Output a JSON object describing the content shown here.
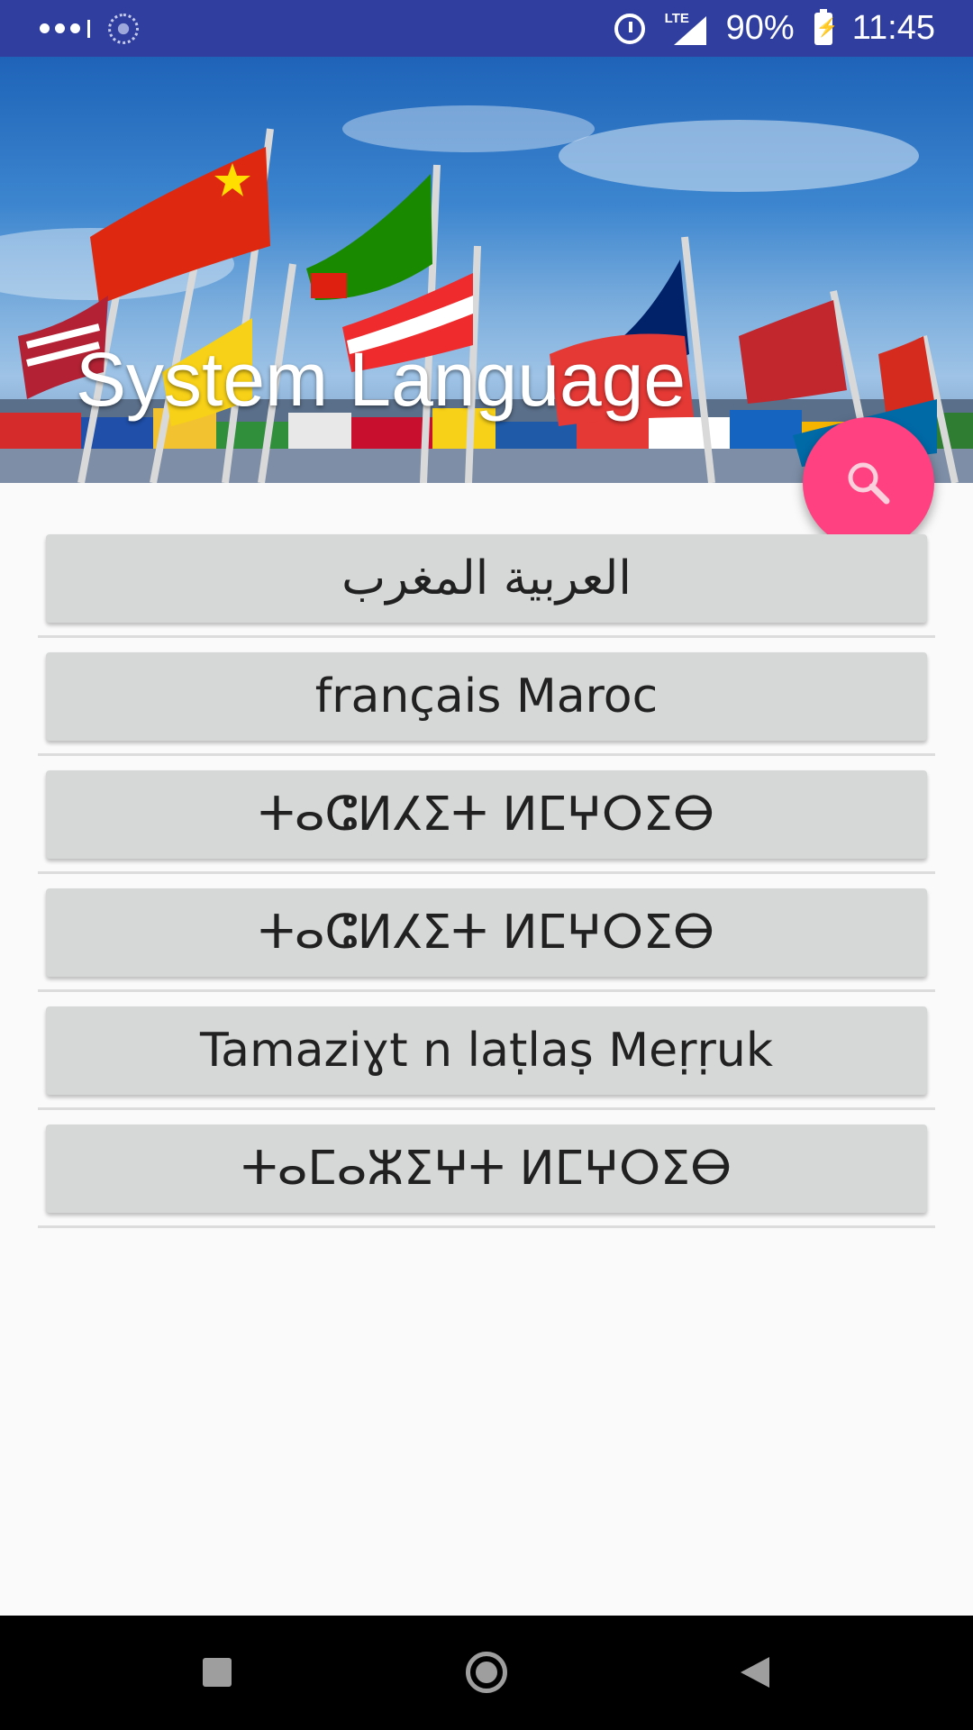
{
  "status_bar": {
    "battery": "90%",
    "network": "LTE",
    "time": "11:45",
    "icons": [
      "signal-dots-icon",
      "loading-icon",
      "alarm-icon",
      "lte-signal-icon",
      "battery-charging-icon"
    ]
  },
  "header": {
    "title": "System Language",
    "background": "flags-photo"
  },
  "fab": {
    "icon": "search-icon",
    "color": "#ff4081"
  },
  "languages": [
    {
      "label": "العربية المغرب"
    },
    {
      "label": "français Maroc"
    },
    {
      "label": "ⵜⴰⵛⵍⵃⵉⵜ ⵍⵎⵖⵔⵉⴱ"
    },
    {
      "label": "ⵜⴰⵛⵍⵃⵉⵜ ⵍⵎⵖⵔⵉⴱ"
    },
    {
      "label": "Tamaziɣt n laṭlaṣ Meṛṛuk"
    },
    {
      "label": "ⵜⴰⵎⴰⵣⵉⵖⵜ ⵍⵎⵖⵔⵉⴱ"
    }
  ],
  "nav_bar": {
    "icons": [
      "recents-icon",
      "home-icon",
      "back-icon"
    ]
  },
  "colors": {
    "status_bar": "#303f9f",
    "accent": "#ff4081",
    "button": "#d6d7d7"
  }
}
